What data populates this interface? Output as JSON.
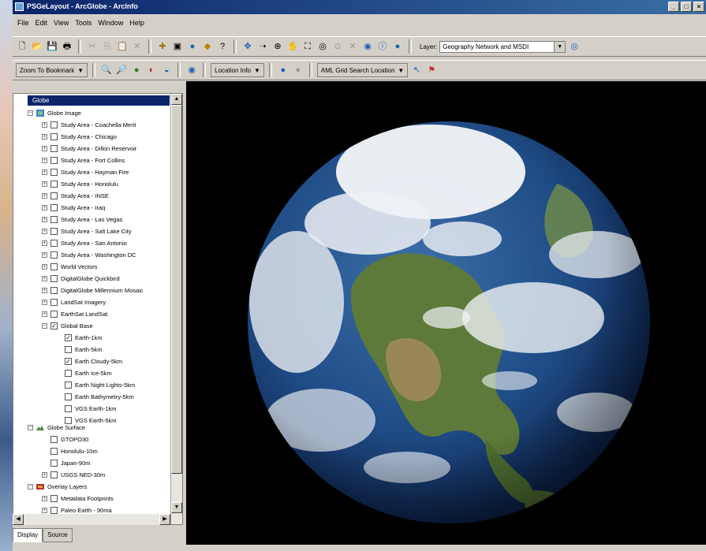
{
  "window": {
    "title": "PSGeLayout - ArcGlobe - ArcInfo"
  },
  "menu": [
    "File",
    "Edit",
    "View",
    "Tools",
    "Window",
    "Help"
  ],
  "toolbar": {
    "layer_label": "Layer:",
    "layer_value": "Geography Network and MSDI"
  },
  "toolbar2": {
    "zoom_bookmark": "Zoom To Bookmark",
    "location_info": "Location Info",
    "search_location": "AML Grid Search Location"
  },
  "toc": {
    "root": "Globe",
    "groups": [
      {
        "label": "Globe Image"
      },
      {
        "label": "Globe Surface"
      },
      {
        "label": "Overlay Layers"
      }
    ],
    "image_layers": [
      "Study Area - Coachella Merit",
      "Study Area - Chicago",
      "Study Area - Dillon Reservoir",
      "Study Area - Fort Collins",
      "Study Area - Hayman Fire",
      "Study Area - Honolulu",
      "Study Area - INSE",
      "Study Area - Iraq",
      "Study Area - Las Vegas",
      "Study Area - Salt Lake City",
      "Study Area - San Antonio",
      "Study Area - Washington DC",
      "World Vectors",
      "DigitalGlobe Quickbird",
      "DigitalGlobe Millennium Mosaic",
      "LandSat Imagery",
      "EarthSat LandSat",
      "Global Base"
    ],
    "base_layers": [
      {
        "label": "Earth-1km",
        "checked": true
      },
      {
        "label": "Earth-5km",
        "checked": false
      },
      {
        "label": "Earth Cloudy-5km",
        "checked": true
      },
      {
        "label": "Earth Ice-5km",
        "checked": false
      },
      {
        "label": "Earth Night Lights-5km",
        "checked": false
      },
      {
        "label": "Earth Bathymetry-5km",
        "checked": false
      },
      {
        "label": "VGS Earth-1km",
        "checked": false
      },
      {
        "label": "VGS Earth-5km",
        "checked": false
      }
    ],
    "surface_layers": [
      "GTOPO30",
      "Honolulu-10m",
      "Japan-90m",
      "USGS NED-30m"
    ],
    "overlay_layers": [
      "Metadata Footprints",
      "Paleo Earth - 90ma"
    ],
    "tabs": [
      "Display",
      "Source"
    ]
  },
  "colors": {
    "title_bar": "#0a246a",
    "selection": "#0a246a",
    "view_background": "#000000"
  }
}
